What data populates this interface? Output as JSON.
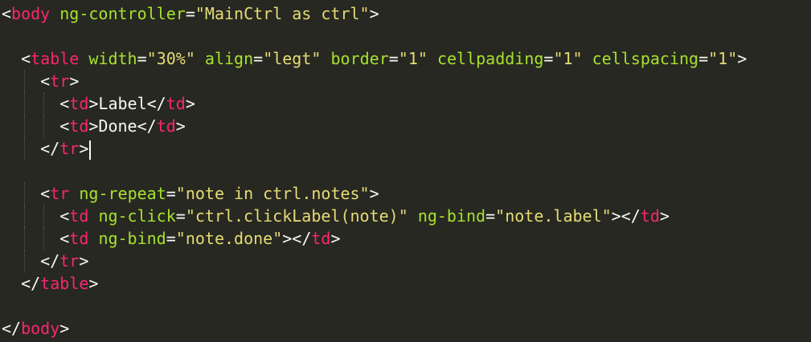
{
  "editor": {
    "language": "html",
    "theme_colors": {
      "background": "#272822",
      "tag": "#f92672",
      "attribute": "#a6e22e",
      "string": "#e6db74",
      "text": "#f8f8f2"
    },
    "lines": [
      [
        {
          "t": "p",
          "v": "<"
        },
        {
          "t": "tag",
          "v": "body"
        },
        {
          "t": "p",
          "v": " "
        },
        {
          "t": "attr",
          "v": "ng-controller"
        },
        {
          "t": "p",
          "v": "="
        },
        {
          "t": "str",
          "v": "\"MainCtrl as ctrl\""
        },
        {
          "t": "p",
          "v": ">"
        }
      ],
      [],
      [
        {
          "t": "p",
          "v": "  <"
        },
        {
          "t": "tag",
          "v": "table"
        },
        {
          "t": "p",
          "v": " "
        },
        {
          "t": "attr",
          "v": "width"
        },
        {
          "t": "p",
          "v": "="
        },
        {
          "t": "str",
          "v": "\"30%\""
        },
        {
          "t": "p",
          "v": " "
        },
        {
          "t": "attr",
          "v": "align"
        },
        {
          "t": "p",
          "v": "="
        },
        {
          "t": "str",
          "v": "\"legt\""
        },
        {
          "t": "p",
          "v": " "
        },
        {
          "t": "attr",
          "v": "border"
        },
        {
          "t": "p",
          "v": "="
        },
        {
          "t": "str",
          "v": "\"1\""
        },
        {
          "t": "p",
          "v": " "
        },
        {
          "t": "attr",
          "v": "cellpadding"
        },
        {
          "t": "p",
          "v": "="
        },
        {
          "t": "str",
          "v": "\"1\""
        },
        {
          "t": "p",
          "v": " "
        },
        {
          "t": "attr",
          "v": "cellspacing"
        },
        {
          "t": "p",
          "v": "="
        },
        {
          "t": "str",
          "v": "\"1\""
        },
        {
          "t": "p",
          "v": ">"
        }
      ],
      [
        {
          "t": "p",
          "v": "    <"
        },
        {
          "t": "tag",
          "v": "tr"
        },
        {
          "t": "p",
          "v": ">"
        }
      ],
      [
        {
          "t": "p",
          "v": "      <"
        },
        {
          "t": "tag",
          "v": "td"
        },
        {
          "t": "p",
          "v": ">Label</"
        },
        {
          "t": "tag",
          "v": "td"
        },
        {
          "t": "p",
          "v": ">"
        }
      ],
      [
        {
          "t": "p",
          "v": "      <"
        },
        {
          "t": "tag",
          "v": "td"
        },
        {
          "t": "p",
          "v": ">Done</"
        },
        {
          "t": "tag",
          "v": "td"
        },
        {
          "t": "p",
          "v": ">"
        }
      ],
      [
        {
          "t": "p",
          "v": "    </"
        },
        {
          "t": "tag",
          "v": "tr"
        },
        {
          "t": "p",
          "v": ">"
        },
        {
          "t": "cursor",
          "v": ""
        }
      ],
      [],
      [
        {
          "t": "p",
          "v": "    <"
        },
        {
          "t": "tag",
          "v": "tr"
        },
        {
          "t": "p",
          "v": " "
        },
        {
          "t": "attr",
          "v": "ng-repeat"
        },
        {
          "t": "p",
          "v": "="
        },
        {
          "t": "str",
          "v": "\"note in ctrl.notes\""
        },
        {
          "t": "p",
          "v": ">"
        }
      ],
      [
        {
          "t": "p",
          "v": "      <"
        },
        {
          "t": "tag",
          "v": "td"
        },
        {
          "t": "p",
          "v": " "
        },
        {
          "t": "attr",
          "v": "ng-click"
        },
        {
          "t": "p",
          "v": "="
        },
        {
          "t": "str",
          "v": "\"ctrl.clickLabel(note)\""
        },
        {
          "t": "p",
          "v": " "
        },
        {
          "t": "attr",
          "v": "ng-bind"
        },
        {
          "t": "p",
          "v": "="
        },
        {
          "t": "str",
          "v": "\"note.label\""
        },
        {
          "t": "p",
          "v": "></"
        },
        {
          "t": "tag",
          "v": "td"
        },
        {
          "t": "p",
          "v": ">"
        }
      ],
      [
        {
          "t": "p",
          "v": "      <"
        },
        {
          "t": "tag",
          "v": "td"
        },
        {
          "t": "p",
          "v": " "
        },
        {
          "t": "attr",
          "v": "ng-bind"
        },
        {
          "t": "p",
          "v": "="
        },
        {
          "t": "str",
          "v": "\"note.done\""
        },
        {
          "t": "p",
          "v": "></"
        },
        {
          "t": "tag",
          "v": "td"
        },
        {
          "t": "p",
          "v": ">"
        }
      ],
      [
        {
          "t": "p",
          "v": "    </"
        },
        {
          "t": "tag",
          "v": "tr"
        },
        {
          "t": "p",
          "v": ">"
        }
      ],
      [
        {
          "t": "p",
          "v": "  </"
        },
        {
          "t": "tag",
          "v": "table"
        },
        {
          "t": "p",
          "v": ">"
        }
      ],
      [],
      [
        {
          "t": "p",
          "v": "</"
        },
        {
          "t": "tag",
          "v": "body"
        },
        {
          "t": "p",
          "v": ">"
        }
      ]
    ]
  }
}
